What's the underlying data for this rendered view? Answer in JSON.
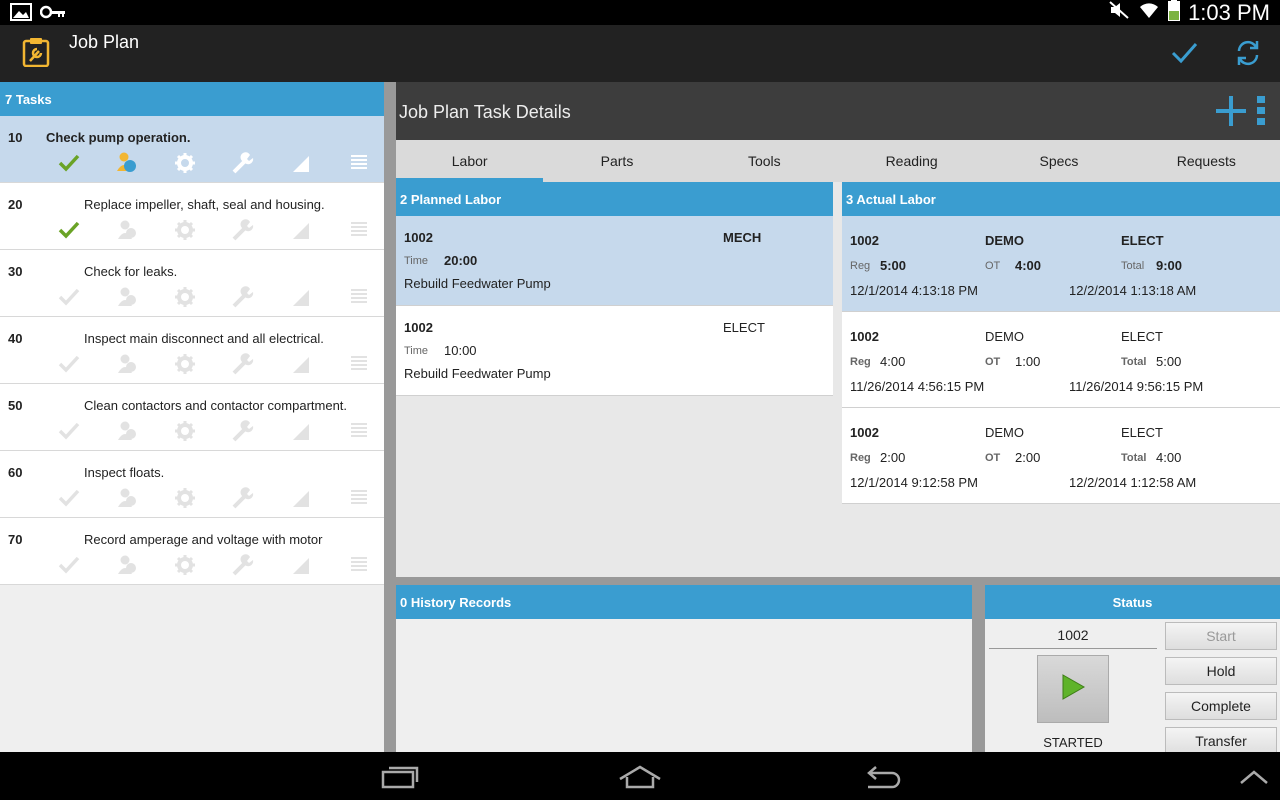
{
  "status_bar": {
    "time": "1:03 PM"
  },
  "app": {
    "title": "Job Plan"
  },
  "tasks_header": "7 Tasks",
  "tasks": [
    {
      "num": "10",
      "desc": "Check pump operation."
    },
    {
      "num": "20",
      "desc": "Replace impeller, shaft, seal and housing."
    },
    {
      "num": "30",
      "desc": "Check for leaks."
    },
    {
      "num": "40",
      "desc": "Inspect main disconnect and all electrical."
    },
    {
      "num": "50",
      "desc": "Clean contactors and contactor compartment."
    },
    {
      "num": "60",
      "desc": "Inspect floats."
    },
    {
      "num": "70",
      "desc": "Record amperage and voltage with motor"
    }
  ],
  "detail": {
    "title": "Job Plan Task Details",
    "tabs": [
      "Labor",
      "Parts",
      "Tools",
      "Reading",
      "Specs",
      "Requests"
    ]
  },
  "planned": {
    "header": "2 Planned Labor",
    "time_label": "Time",
    "rows": [
      {
        "id": "1002",
        "craft": "MECH",
        "time": "20:00",
        "desc": "Rebuild Feedwater Pump"
      },
      {
        "id": "1002",
        "craft": "ELECT",
        "time": "10:00",
        "desc": "Rebuild Feedwater Pump"
      }
    ]
  },
  "actual": {
    "header": "3 Actual Labor",
    "reg_label": "Reg",
    "ot_label": "OT",
    "total_label": "Total",
    "rows": [
      {
        "id": "1002",
        "org": "DEMO",
        "craft": "ELECT",
        "reg": "5:00",
        "ot": "4:00",
        "total": "9:00",
        "start": "12/1/2014 4:13:18 PM",
        "end": "12/2/2014 1:13:18 AM"
      },
      {
        "id": "1002",
        "org": "DEMO",
        "craft": "ELECT",
        "reg": "4:00",
        "ot": "1:00",
        "total": "5:00",
        "start": "11/26/2014 4:56:15 PM",
        "end": "11/26/2014 9:56:15 PM"
      },
      {
        "id": "1002",
        "org": "DEMO",
        "craft": "ELECT",
        "reg": "2:00",
        "ot": "2:00",
        "total": "4:00",
        "start": "12/1/2014 9:12:58 PM",
        "end": "12/2/2014 1:12:58 AM"
      }
    ]
  },
  "history": {
    "header": "0 History Records"
  },
  "status_panel": {
    "header": "Status",
    "id": "1002",
    "state": "STARTED",
    "buttons": {
      "start": "Start",
      "hold": "Hold",
      "complete": "Complete",
      "transfer": "Transfer"
    }
  },
  "colors": {
    "accent": "#3a9dd0",
    "check_green": "#6aa326"
  }
}
